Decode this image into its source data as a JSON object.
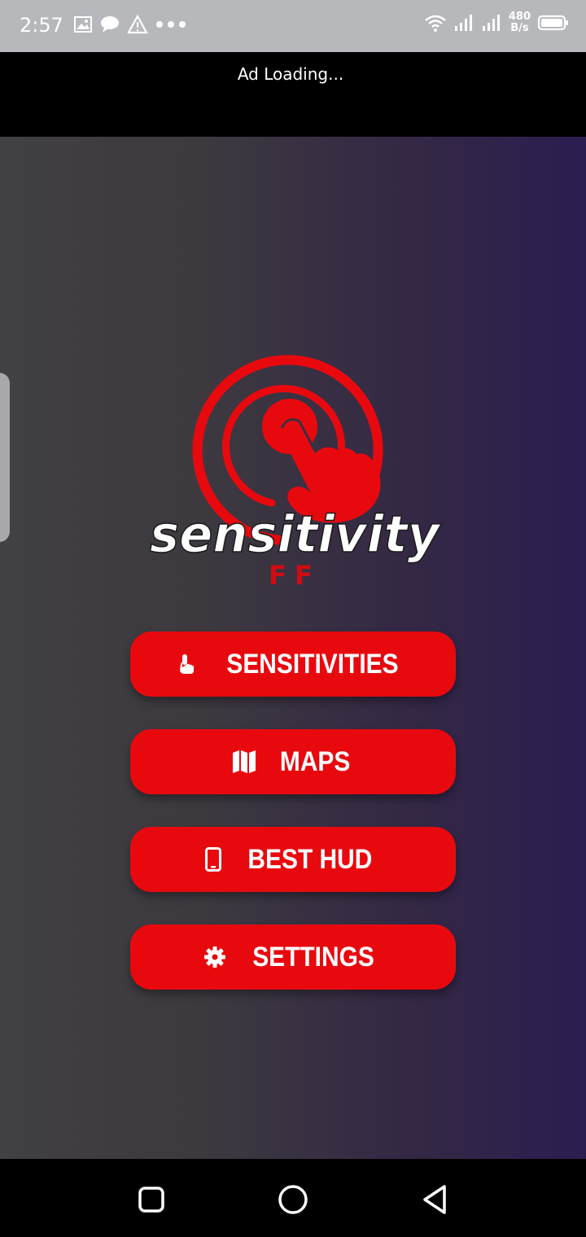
{
  "status_bar": {
    "time": "2:57",
    "left_icons": [
      "gallery-icon",
      "chat-icon",
      "warning-icon",
      "more-dots-icon"
    ],
    "net_speed_value": "480",
    "net_speed_unit": "B/s",
    "right_icons": [
      "wifi-icon",
      "signal-icon",
      "signal-icon",
      "battery-icon"
    ]
  },
  "ad": {
    "text": "Ad Loading..."
  },
  "logo": {
    "word": "sensitivity",
    "sub": "FF"
  },
  "menu": {
    "items": [
      {
        "label": "SENSITIVITIES",
        "icon": "hand-pointer-icon"
      },
      {
        "label": "MAPS",
        "icon": "map-icon"
      },
      {
        "label": "BEST HUD",
        "icon": "mobile-phone-icon"
      },
      {
        "label": "SETTINGS",
        "icon": "gear-icon"
      }
    ]
  },
  "colors": {
    "accent": "#e8090f",
    "background_left": "#414043",
    "background_right": "#2b1d50",
    "status_bar": "#b7b8bc"
  },
  "nav_bar": {
    "buttons": [
      "recent-apps-icon",
      "home-icon",
      "back-icon"
    ]
  }
}
